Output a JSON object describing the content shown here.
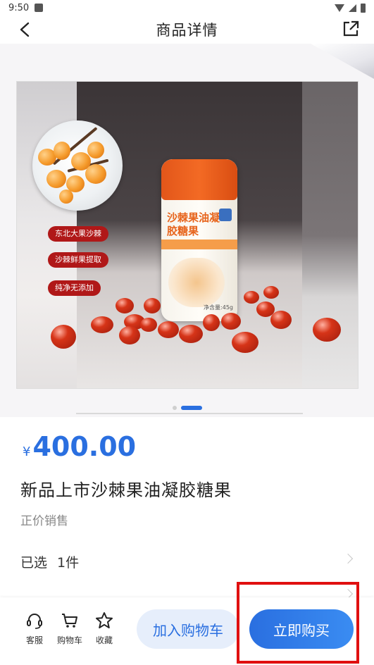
{
  "status_bar": {
    "time": "9:50"
  },
  "header": {
    "title": "商品详情"
  },
  "gallery": {
    "current_index": 1,
    "total": 2,
    "image": {
      "tags": [
        "东北大果沙棘",
        "沙棘鲜果提取",
        "纯净无添加"
      ],
      "bottle_label": "沙棘果油凝胶糖果",
      "net_weight": "净含量:45g"
    }
  },
  "product": {
    "currency": "¥",
    "price": "400.00",
    "name": "新品上市沙棘果油凝胶糖果",
    "sale_tag": "正价销售",
    "selected_label": "已选",
    "selected_value": "1件"
  },
  "bottom_bar": {
    "service_label": "客服",
    "cart_label": "购物车",
    "favorite_label": "收藏",
    "add_to_cart": "加入购物车",
    "buy_now": "立即购买"
  },
  "colors": {
    "accent": "#2a6fe0",
    "highlight_box": "#e01010"
  }
}
